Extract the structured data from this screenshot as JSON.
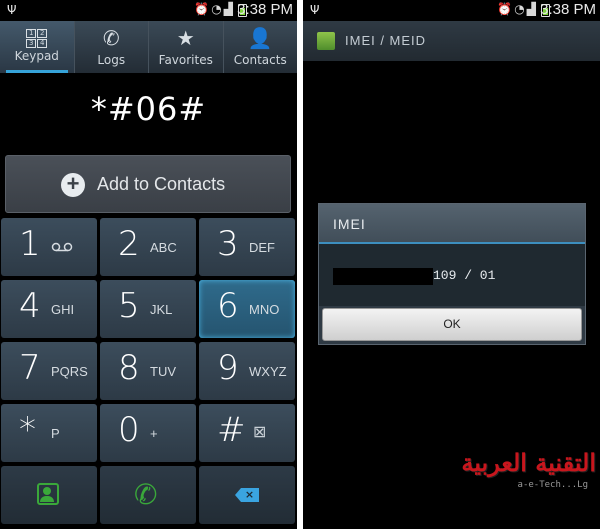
{
  "status_bar": {
    "time": "3:38 PM"
  },
  "dialer": {
    "tabs": [
      {
        "label": "Keypad",
        "active": true,
        "icon": "keypad-icon"
      },
      {
        "label": "Logs",
        "active": false,
        "icon": "logs-icon"
      },
      {
        "label": "Favorites",
        "active": false,
        "icon": "star-icon"
      },
      {
        "label": "Contacts",
        "active": false,
        "icon": "person-icon"
      }
    ],
    "keypad_glyph": [
      "1",
      "2",
      "3",
      "4"
    ],
    "dialed_number": "*#06#",
    "add_to_contacts_label": "Add to Contacts",
    "keys": [
      {
        "digit": "1",
        "letters": ""
      },
      {
        "digit": "2",
        "letters": "ABC"
      },
      {
        "digit": "3",
        "letters": "DEF"
      },
      {
        "digit": "4",
        "letters": "GHI"
      },
      {
        "digit": "5",
        "letters": "JKL"
      },
      {
        "digit": "6",
        "letters": "MNO"
      },
      {
        "digit": "7",
        "letters": "PQRS"
      },
      {
        "digit": "8",
        "letters": "TUV"
      },
      {
        "digit": "9",
        "letters": "WXYZ"
      },
      {
        "digit": "*",
        "letters": "P"
      },
      {
        "digit": "0",
        "letters": "+"
      },
      {
        "digit": "#",
        "letters": ""
      }
    ]
  },
  "imei_screen": {
    "title": "IMEI / MEID",
    "dialog_title": "IMEI",
    "imei_visible": "109 / 01",
    "ok_label": "OK"
  },
  "watermark": {
    "main": "التقنية العربية",
    "sub": "a-e-Tech...Lg"
  },
  "colors": {
    "accent_blue": "#36a3d9",
    "call_green": "#3aa83a",
    "watermark_red": "#c8161d"
  }
}
